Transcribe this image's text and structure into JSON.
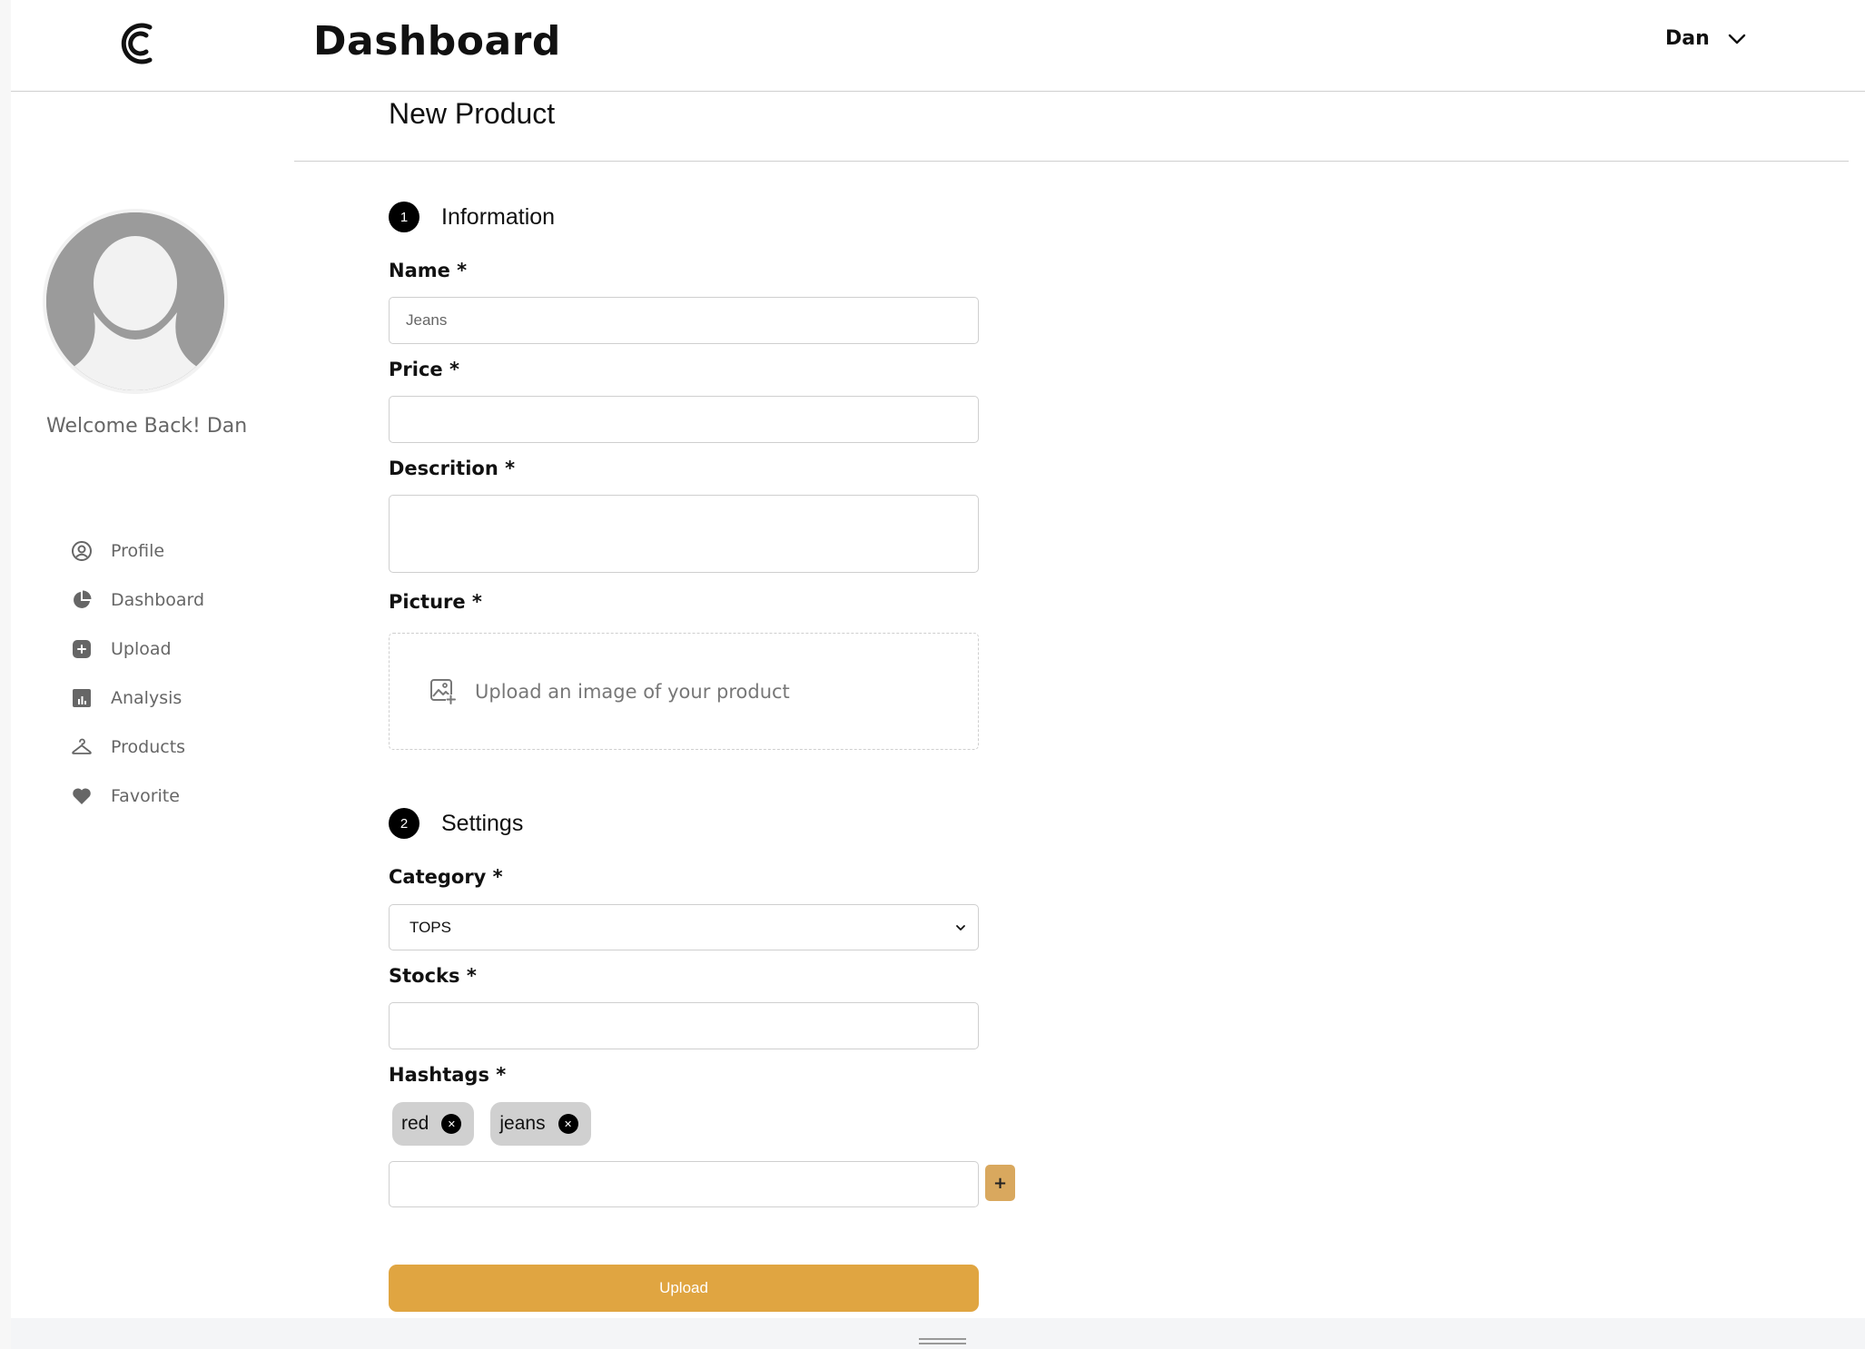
{
  "header": {
    "title": "Dashboard",
    "user_name": "Dan"
  },
  "sidebar": {
    "welcome": "Welcome Back! Dan",
    "items": [
      {
        "label": "Profile",
        "icon": "user-circle-icon"
      },
      {
        "label": "Dashboard",
        "icon": "pie-chart-icon"
      },
      {
        "label": "Upload",
        "icon": "plus-square-icon"
      },
      {
        "label": "Analysis",
        "icon": "bar-chart-icon"
      },
      {
        "label": "Products",
        "icon": "hanger-icon"
      },
      {
        "label": "Favorite",
        "icon": "heart-icon"
      }
    ]
  },
  "main": {
    "page_title": "New Product",
    "section_information": {
      "number": "1",
      "label": "Information"
    },
    "name": {
      "label": "Name *",
      "placeholder": "Jeans"
    },
    "price": {
      "label": "Price *"
    },
    "description": {
      "label": "Descrition *"
    },
    "picture": {
      "label": "Picture *",
      "dropzone_text": "Upload an image of your product"
    },
    "section_settings": {
      "number": "2",
      "label": "Settings"
    },
    "category": {
      "label": "Category *",
      "selected": "TOPS"
    },
    "stocks": {
      "label": "Stocks *"
    },
    "hashtags": {
      "label": "Hashtags *",
      "tags": [
        "red",
        "jeans"
      ],
      "add_label": "+"
    },
    "upload_label": "Upload"
  },
  "colors": {
    "accent": "#e0a541",
    "add_button": "#d9a85e",
    "tag_bg": "#d0d0d0",
    "sidebar_text": "#666666"
  }
}
